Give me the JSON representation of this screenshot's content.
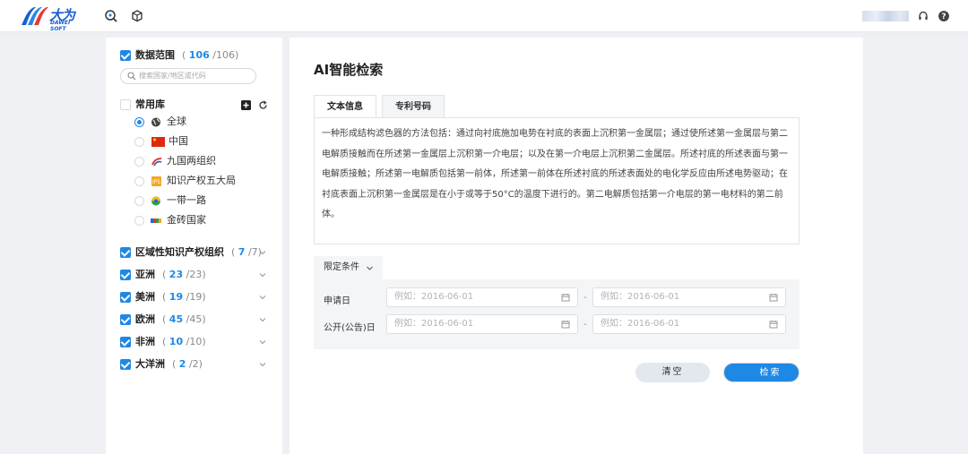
{
  "brand": {
    "name_cn": "大为",
    "name_en": "DAWEI SOFT",
    "color": "#1a5fd0"
  },
  "accent": "#1e88e5",
  "toolbar_icons": [
    "search-history-icon",
    "cube-icon"
  ],
  "header_right_icons": [
    "headset-icon",
    "help-icon"
  ],
  "sidebar": {
    "data_scope": {
      "label": "数据范围",
      "selected": "106",
      "total": "/106",
      "open": "(",
      "close": ")"
    },
    "search_placeholder": "搜索国家/地区或代码",
    "common": {
      "label": "常用库",
      "options": [
        {
          "label": "全球",
          "icon": "globe-icon",
          "selected": true
        },
        {
          "label": "中国",
          "icon": "china-flag-icon",
          "selected": false
        },
        {
          "label": "九国两组织",
          "icon": "nine-nations-icon",
          "selected": false
        },
        {
          "label": "知识产权五大局",
          "icon": "ip5-icon",
          "selected": false
        },
        {
          "label": "一带一路",
          "icon": "belt-road-icon",
          "selected": false
        },
        {
          "label": "金砖国家",
          "icon": "brics-icon",
          "selected": false
        }
      ]
    },
    "groups": [
      {
        "label": "区域性知识产权组织",
        "selected": "7",
        "total": "/7)",
        "open": "("
      },
      {
        "label": "亚洲",
        "selected": "23",
        "total": "/23)",
        "open": "("
      },
      {
        "label": "美洲",
        "selected": "19",
        "total": "/19)",
        "open": "("
      },
      {
        "label": "欧洲",
        "selected": "45",
        "total": "/45)",
        "open": "("
      },
      {
        "label": "非洲",
        "selected": "10",
        "total": "/10)",
        "open": "("
      },
      {
        "label": "大洋洲",
        "selected": "2",
        "total": "/2)",
        "open": "("
      }
    ]
  },
  "main": {
    "title": "AI智能检索",
    "tabs": [
      {
        "label": "文本信息",
        "active": true
      },
      {
        "label": "专利号码",
        "active": false
      }
    ],
    "query_text": "一种形成结构滤色器的方法包括：通过向衬底施加电势在衬底的表面上沉积第一金属层；通过使所述第一金属层与第二电解质接触而在所述第一金属层上沉积第一介电层；以及在第一介电层上沉积第二金属层。所述衬底的所述表面与第一电解质接触；所述第一电解质包括第一前体，所述第一前体在所述衬底的所述表面处的电化学反应由所述电势驱动；在衬底表面上沉积第一金属层是在小于或等于50°C的温度下进行的。第二电解质包括第一介电层的第一电材料的第二前体。",
    "conditions": {
      "label": "限定条件",
      "fields": [
        {
          "label": "申请日",
          "start_placeholder": "例如：2016-06-01",
          "end_placeholder": "例如：2016-06-01"
        },
        {
          "label": "公开(公告)日",
          "start_placeholder": "例如：2016-06-01",
          "end_placeholder": "例如：2016-06-01"
        }
      ],
      "separator": "-"
    },
    "buttons": {
      "clear": "清空",
      "search": "检索"
    }
  }
}
